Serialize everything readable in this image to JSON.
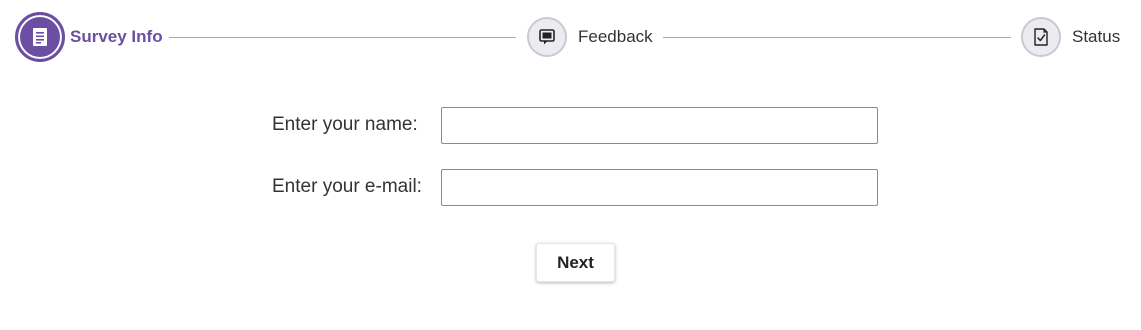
{
  "colors": {
    "accent": "#6a4fa2",
    "inactive_circle": "#ececf0",
    "connector": "#a8a8b0"
  },
  "stepper": {
    "steps": [
      {
        "label": "Survey Info",
        "icon": "document-list-icon",
        "state": "active"
      },
      {
        "label": "Feedback",
        "icon": "chat-bubble-icon",
        "state": "inactive"
      },
      {
        "label": "Status",
        "icon": "checklist-icon",
        "state": "inactive"
      }
    ]
  },
  "form": {
    "name_label": "Enter your name:",
    "name_value": "",
    "email_label": "Enter your e-mail:",
    "email_value": "",
    "next_label": "Next"
  }
}
